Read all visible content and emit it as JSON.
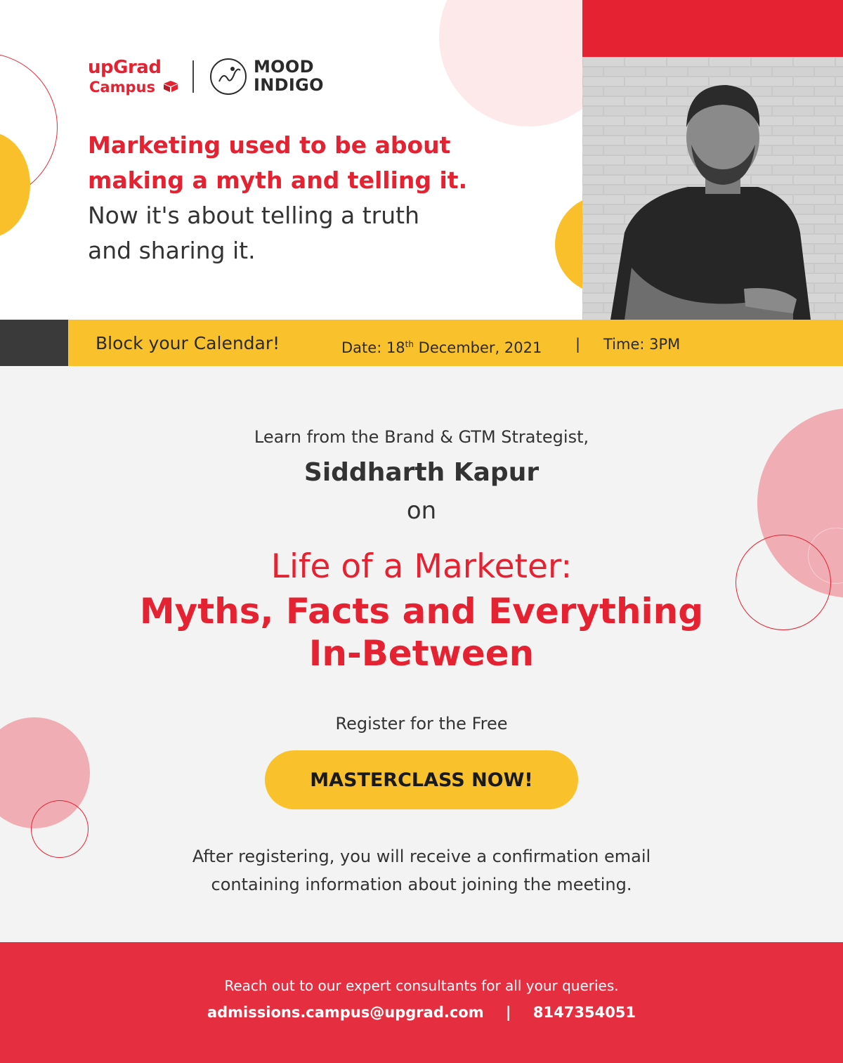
{
  "brand": {
    "upgrad_line1": "upGrad",
    "upgrad_line2": "Campus",
    "partner_line1": "MOOD",
    "partner_line2": "INDIGO",
    "colors": {
      "red": "#e52232",
      "yellow": "#f9c12c",
      "dark": "#3a3a3a",
      "pink": "#f0adb3"
    }
  },
  "hero": {
    "quote_bold_line1": "Marketing used to be about",
    "quote_bold_line2": "making a myth and telling it.",
    "quote_line3": "Now it's about telling a truth",
    "quote_line4": "and sharing it."
  },
  "calendar": {
    "heading": "Block your Calendar!",
    "date_prefix": "Date: 18",
    "date_suffix": "th",
    "date_rest": " December, 2021",
    "separator": "|",
    "time": "Time: 3PM"
  },
  "session": {
    "intro": "Learn from the Brand & GTM Strategist,",
    "speaker": "Siddharth Kapur",
    "connector": "on",
    "title_line1": "Life of a Marketer:",
    "title_line2": "Myths, Facts and Everything",
    "title_line3": "In-Between",
    "register_text": "Register for the Free",
    "cta_label": "MASTERCLASS NOW!",
    "note_line1": "After registering, you will receive a confirmation email",
    "note_line2": "containing information about joining the meeting."
  },
  "footer": {
    "reach_out": "Reach out to our expert consultants for all your queries.",
    "email": "admissions.campus@upgrad.com",
    "separator": "|",
    "phone": "8147354051"
  },
  "icons": [
    "upgrad-cube-icon",
    "mood-indigo-emblem-icon",
    "speaker-photo"
  ]
}
